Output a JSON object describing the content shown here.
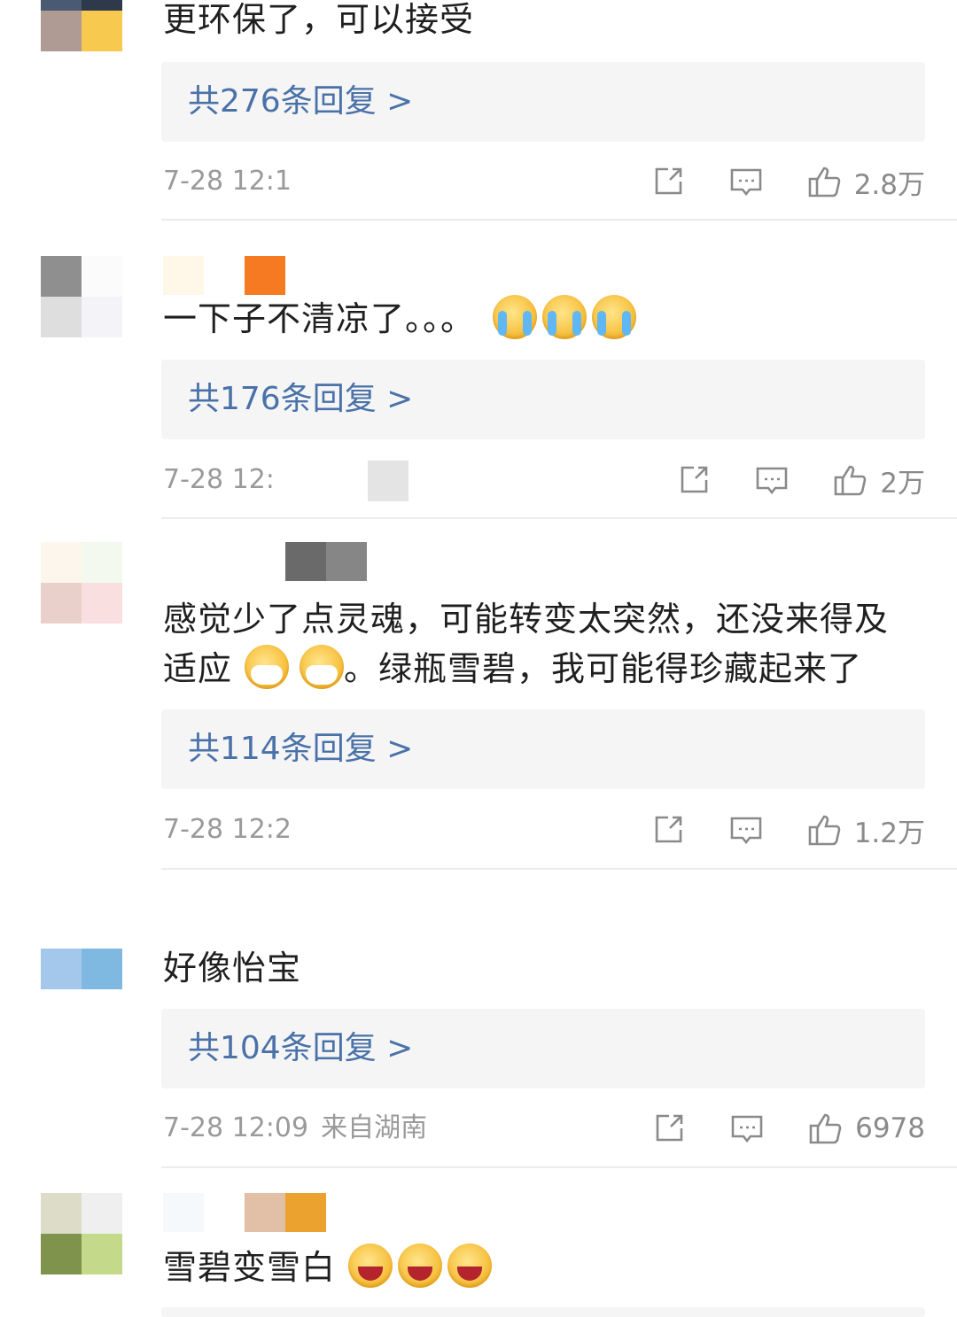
{
  "colors": {
    "reply_link": "#4a72a8",
    "meta": "#9a9a9a",
    "reply_bg": "#f5f5f5"
  },
  "comments": [
    {
      "text": "更环保了，可以接受",
      "replies": "共276条回复 >",
      "time": "7-28 12:1",
      "location": "",
      "likes": "2.8万"
    },
    {
      "text": "一下子不清凉了。。。",
      "emojis": [
        "crying-emoji",
        "crying-emoji",
        "crying-emoji"
      ],
      "replies": "共176条回复 >",
      "time": "7-28 12:",
      "location": "",
      "likes": "2万"
    },
    {
      "text_line1": "感觉少了点灵魂，可能转变太突然，还没来得及",
      "text_line2_a": "适应",
      "text_line2_b": "。绿瓶雪碧，我可能得珍藏起来了",
      "emojis": [
        "mask-emoji",
        "mask-emoji"
      ],
      "replies": "共114条回复 >",
      "time": "7-28 12:2",
      "location": "",
      "likes": "1.2万"
    },
    {
      "text": "好像怡宝",
      "replies": "共104条回复 >",
      "time": "7-28 12:09",
      "location": "来自湖南",
      "likes": "6978"
    },
    {
      "text": "雪碧变雪白",
      "emojis": [
        "laughing-emoji",
        "laughing-emoji",
        "laughing-emoji"
      ]
    }
  ],
  "icons": {
    "repost": "repost-icon",
    "comment": "comment-icon",
    "like": "thumbs-up-icon"
  }
}
